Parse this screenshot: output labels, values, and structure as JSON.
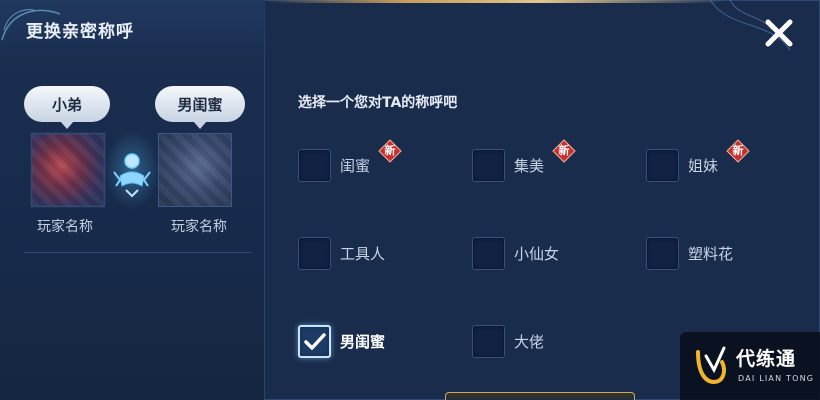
{
  "dialog": {
    "title": "更换亲密称呼",
    "close_icon": "close-icon"
  },
  "left": {
    "bubble_left": "小弟",
    "bubble_right": "男闺蜜",
    "player_left_name": "玩家名称",
    "player_right_name": "玩家名称",
    "link_icon": "intimacy-link-icon"
  },
  "right": {
    "prompt": "选择一个您对TA的称呼吧",
    "options": [
      {
        "label": "闺蜜",
        "checked": false,
        "new": true
      },
      {
        "label": "集美",
        "checked": false,
        "new": true
      },
      {
        "label": "姐妹",
        "checked": false,
        "new": true
      },
      {
        "label": "工具人",
        "checked": false,
        "new": false
      },
      {
        "label": "小仙女",
        "checked": false,
        "new": false
      },
      {
        "label": "塑料花",
        "checked": false,
        "new": false
      },
      {
        "label": "男闺蜜",
        "checked": true,
        "new": false
      },
      {
        "label": "大佬",
        "checked": false,
        "new": false
      }
    ],
    "new_badge_text": "新"
  },
  "watermark": {
    "text_cn": "代练通",
    "text_en": "DAI LIAN TONG"
  },
  "colors": {
    "panel_bg": "#1a2c4c",
    "accent_gold": "#c79c5a",
    "new_badge_red": "#c8312b"
  }
}
